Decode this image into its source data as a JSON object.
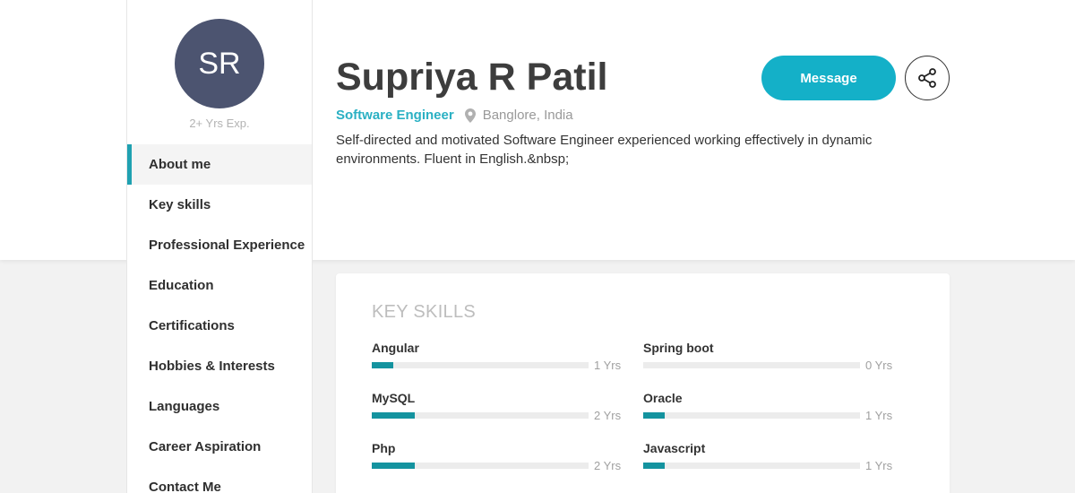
{
  "profile": {
    "initials": "SR",
    "experience": "2+ Yrs Exp.",
    "name": "Supriya R Patil",
    "role": "Software Engineer",
    "location": "Banglore, India",
    "bio": "Self-directed and motivated Software Engineer experienced working effectively in dynamic environments. Fluent in English.&nbsp;"
  },
  "actions": {
    "message_label": "Message",
    "share_icon": "share-icon"
  },
  "nav": {
    "items": [
      {
        "label": "About me",
        "active": true
      },
      {
        "label": "Key skills",
        "active": false
      },
      {
        "label": "Professional Experience",
        "active": false
      },
      {
        "label": "Education",
        "active": false
      },
      {
        "label": "Certifications",
        "active": false
      },
      {
        "label": "Hobbies & Interests",
        "active": false
      },
      {
        "label": "Languages",
        "active": false
      },
      {
        "label": "Career Aspiration",
        "active": false
      },
      {
        "label": "Contact Me",
        "active": false
      }
    ]
  },
  "key_skills": {
    "title": "KEY SKILLS",
    "items": [
      {
        "name": "Angular",
        "years": "1 Yrs",
        "level": 0.1
      },
      {
        "name": "Spring boot",
        "years": "0 Yrs",
        "level": 0.0
      },
      {
        "name": "MySQL",
        "years": "2 Yrs",
        "level": 0.2
      },
      {
        "name": "Oracle",
        "years": "1 Yrs",
        "level": 0.1
      },
      {
        "name": "Php",
        "years": "2 Yrs",
        "level": 0.2
      },
      {
        "name": "Javascript",
        "years": "1 Yrs",
        "level": 0.1
      }
    ]
  },
  "colors": {
    "accent": "#14b0c8",
    "bar_fill": "#14939f",
    "avatar_bg": "#4c5470"
  }
}
